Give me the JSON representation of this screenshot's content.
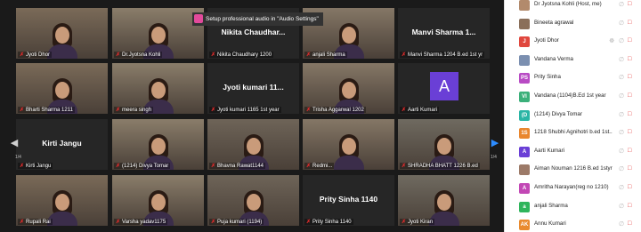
{
  "notice": "Setup professional audio in \"Audio Settings\"",
  "page_indicator_left": "1/4",
  "page_indicator_right": "1/4",
  "gallery": {
    "tiles": [
      {
        "label": "Jyoti Dhor",
        "video": true
      },
      {
        "label": "Dr.Jyotsna Kohli",
        "video": true
      },
      {
        "name": "Nikita Chaudhar...",
        "label": "Nikita Chaudhary 1200",
        "video": false
      },
      {
        "label": "anjali Sharma",
        "video": true
      },
      {
        "name": "Manvi Sharma 1...",
        "label": "Manvi Sharma 1204 B.ed 1st yr",
        "video": false
      },
      {
        "label": "Bharti Sharma 1211",
        "video": true
      },
      {
        "label": "meera singh",
        "video": true
      },
      {
        "name": "Jyoti kumari 11...",
        "label": "Jyoti kumari 1165 1st year",
        "video": false
      },
      {
        "label": "Trisha Aggarwal 1202",
        "video": true
      },
      {
        "label": "Aarti Kumari",
        "video": false,
        "avatar": "A"
      },
      {
        "name": "Kirti Jangu",
        "label": "Kirti Jangu",
        "video": false
      },
      {
        "label": "(1214) Divya Tomar",
        "video": true
      },
      {
        "label": "Bhavna Rawat1144",
        "video": true
      },
      {
        "label": "Redmi...",
        "video": true
      },
      {
        "label": "SHRADHA BHATT 1226 B.ed",
        "video": true
      },
      {
        "label": "Rupali Rai",
        "video": true
      },
      {
        "label": "Varsha yadav1175",
        "video": true
      },
      {
        "label": "Puja kumari (1194)",
        "video": true
      },
      {
        "name": "Prity Sinha 1140",
        "label": "Prity Sinha 1140",
        "video": false
      },
      {
        "label": "Jyoti Kiran",
        "video": true
      }
    ]
  },
  "participants": [
    {
      "name": "Dr Jyotsna Kohli (Host, me)",
      "initials": "",
      "color": "#b28a6c"
    },
    {
      "name": "Bineeta agrawal",
      "initials": "",
      "color": "#8a6f5a"
    },
    {
      "name": "Jyoti Dhor",
      "initials": "J",
      "color": "#e0473e"
    },
    {
      "name": "Vandana Verma",
      "initials": "",
      "color": "#7b8fb0"
    },
    {
      "name": "Prity Sinha",
      "initials": "PS",
      "color": "#b84bc4"
    },
    {
      "name": "Vandana (1104)B.Ed 1st year",
      "initials": "VI",
      "color": "#3bb07a"
    },
    {
      "name": "(1214) Divya Tomar",
      "initials": "(D",
      "color": "#2ab5a5"
    },
    {
      "name": "1218 Shubhi Agnihotri b.ed 1st...",
      "initials": "1S",
      "color": "#e9862e"
    },
    {
      "name": "Aarti Kumari",
      "initials": "A",
      "color": "#6a3fd6"
    },
    {
      "name": "Aiman Nouman 1216 B.ed 1styr",
      "initials": "",
      "color": "#9c7a68"
    },
    {
      "name": "Amritha Narayan(reg no 1210)",
      "initials": "A",
      "color": "#c247b5"
    },
    {
      "name": "anjali Sharma",
      "initials": "a",
      "color": "#2fb55c"
    },
    {
      "name": "Annu Kumari",
      "initials": "AK",
      "color": "#e98a2e"
    }
  ]
}
